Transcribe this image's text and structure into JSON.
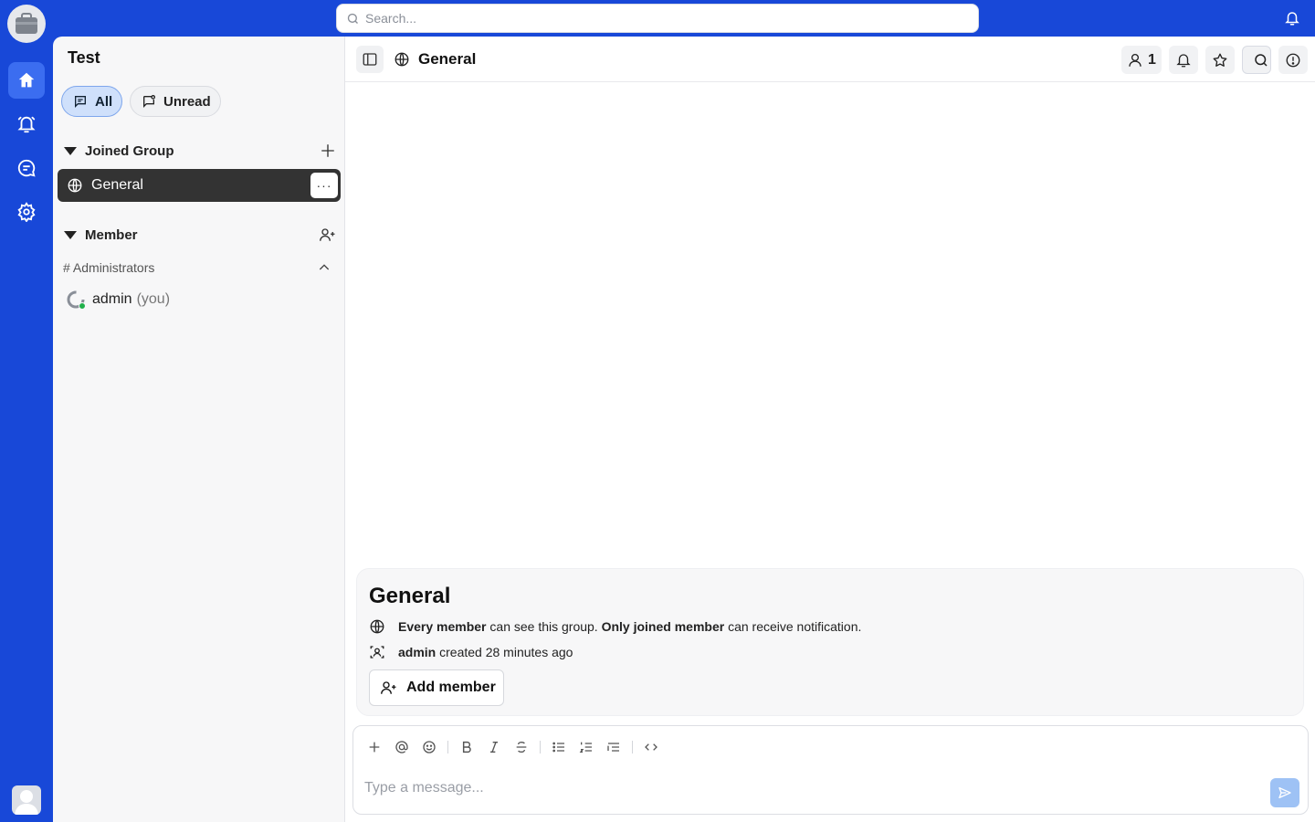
{
  "search": {
    "placeholder": "Search..."
  },
  "workspace": {
    "title": "Test"
  },
  "filters": {
    "all_label": "All",
    "unread_label": "Unread"
  },
  "sections": {
    "joined_group": {
      "label": "Joined Group"
    },
    "member": {
      "label": "Member"
    }
  },
  "channels": [
    {
      "name": "General",
      "more": "···"
    }
  ],
  "roles": [
    {
      "label": "# Administrators"
    }
  ],
  "members": [
    {
      "name": "admin",
      "suffix": "(you)"
    }
  ],
  "header": {
    "channel_title": "General",
    "member_count": "1"
  },
  "intro": {
    "title": "General",
    "visibility": {
      "b1": "Every member",
      "t1": " can see this group. ",
      "b2": "Only joined member",
      "t2": " can receive notification."
    },
    "created": {
      "user": "admin",
      "text": " created 28 minutes ago"
    },
    "add_member_label": "Add member"
  },
  "composer": {
    "placeholder": "Type a message..."
  },
  "colors": {
    "brand": "#1848d8",
    "accent": "#3b6df0",
    "online": "#21b04b",
    "send": "#9ec2f5"
  }
}
